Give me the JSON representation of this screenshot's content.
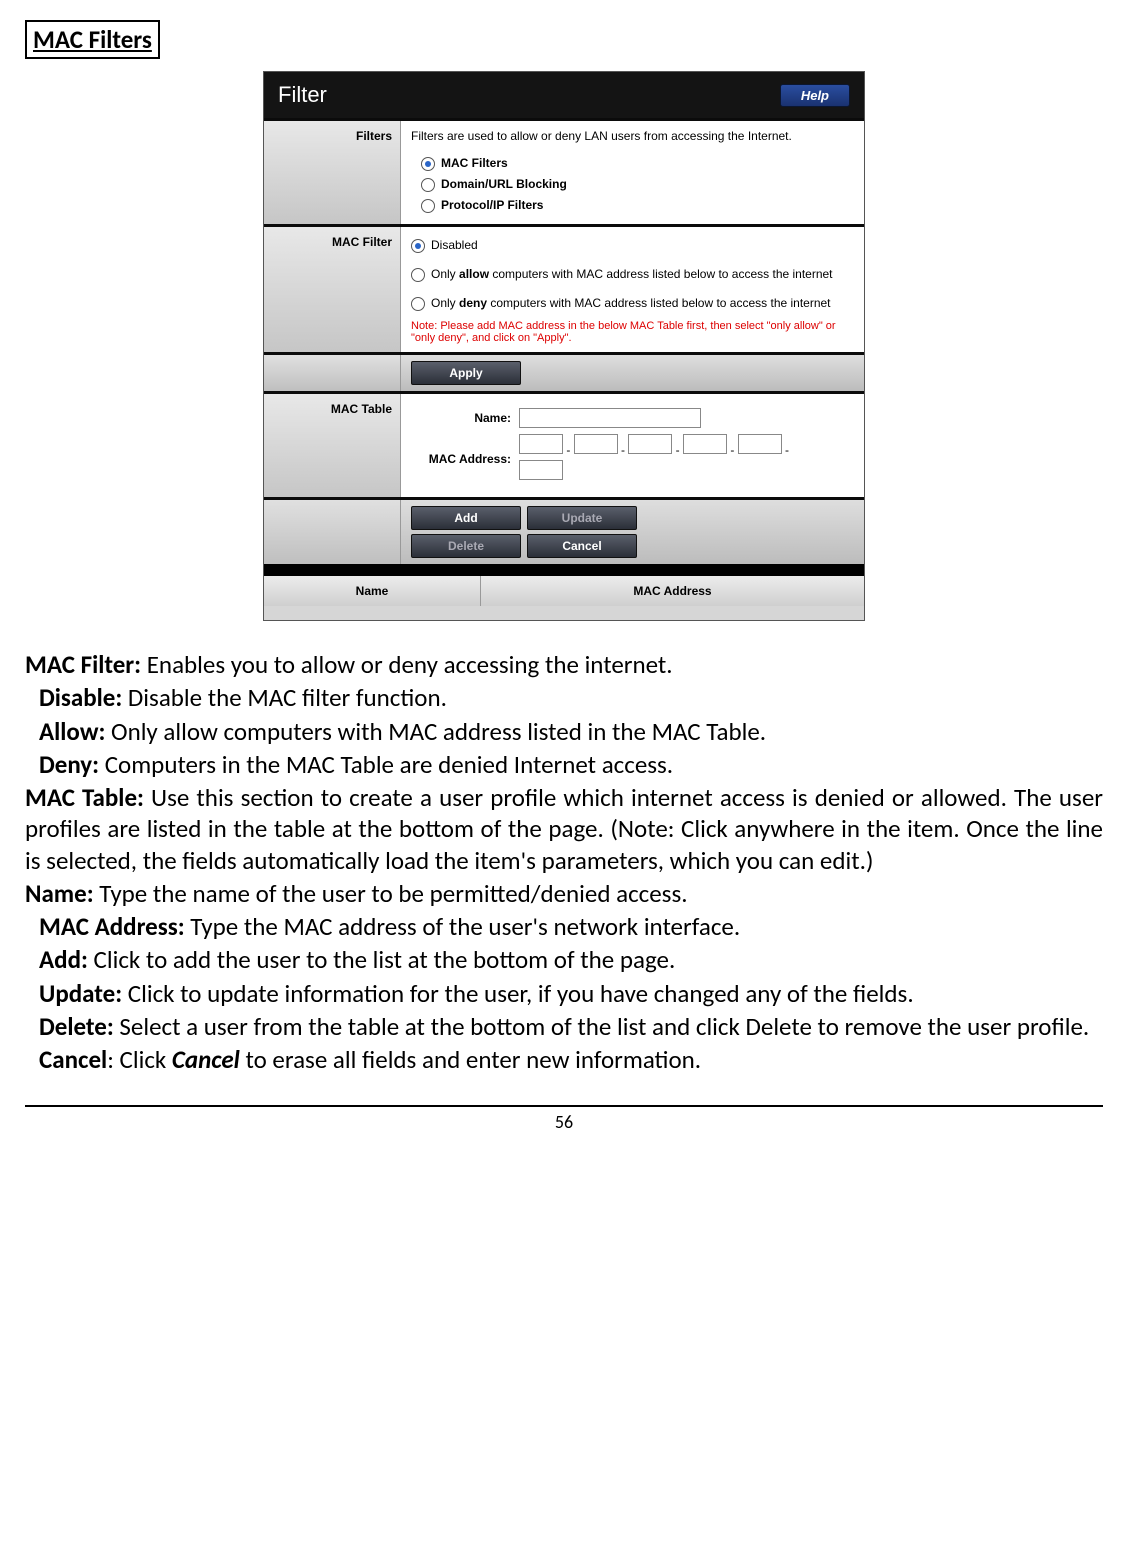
{
  "title": "MAC Filters",
  "screenshot": {
    "window_title": "Filter",
    "help_label": "Help",
    "filters_section": {
      "label": "Filters",
      "intro": "Filters are used to allow or deny LAN users from accessing the Internet.",
      "options": [
        {
          "label": "MAC Filters",
          "bold": true,
          "selected": true
        },
        {
          "label": "Domain/URL Blocking",
          "bold": true,
          "selected": false
        },
        {
          "label": "Protocol/IP Filters",
          "bold": true,
          "selected": false
        }
      ]
    },
    "mac_filter_section": {
      "label": "MAC Filter",
      "options": [
        {
          "text": "Disabled",
          "selected": true
        },
        {
          "prefix": "Only ",
          "bold": "allow",
          "suffix": " computers with MAC address listed below to access the internet",
          "selected": false
        },
        {
          "prefix": "Only ",
          "bold": "deny",
          "suffix": " computers with MAC address listed below to access the internet",
          "selected": false
        }
      ],
      "note": "Note: Please add MAC address in the below MAC Table first, then select \"only allow\" or \"only deny\", and click on \"Apply\"."
    },
    "apply_label": "Apply",
    "mac_table_section": {
      "label": "MAC Table",
      "name_label": "Name:",
      "mac_label": "MAC Address:"
    },
    "action_buttons": {
      "add": "Add",
      "update": "Update",
      "delete": "Delete",
      "cancel": "Cancel"
    },
    "table_headers": {
      "name": "Name",
      "mac": "MAC Address"
    }
  },
  "desc": {
    "mac_filter_label": "MAC Filter:",
    "mac_filter_text": " Enables you to allow or deny accessing the internet.",
    "disable_label": "Disable:",
    "disable_text": " Disable the MAC filter function.",
    "allow_label": "Allow:",
    "allow_text": " Only allow computers with MAC address listed in the MAC Table.",
    "deny_label": "Deny:",
    "deny_text": " Computers in the MAC Table are denied Internet access.",
    "mac_table_label": "MAC Table:",
    "mac_table_text": " Use this section to create a user profile which internet access is denied or allowed.  The user profiles are listed in the table at the bottom of the page.  (Note: Click anywhere in the item. Once the line is selected, the fields automatically load the item's parameters, which you can edit.)",
    "name_label": "Name:",
    "name_text": " Type the name of the user to be permitted/denied access.",
    "mac_addr_label": "MAC Address:",
    "mac_addr_text": " Type the MAC address of the user's network interface.",
    "add_label": "Add:",
    "add_text": " Click to add the user to the list at the bottom of the page.",
    "update_label": "Update:",
    "update_text": " Click to update information for the user, if you have changed any of the fields.",
    "delete_label": "Delete:",
    "delete_text": " Select a user from the table at the bottom of the list and click Delete to remove the user profile.",
    "cancel_label": "Cancel",
    "cancel_mid": ": Click ",
    "cancel_bold": "Cancel",
    "cancel_text": " to erase all fields and enter new information."
  },
  "page_number": "56"
}
